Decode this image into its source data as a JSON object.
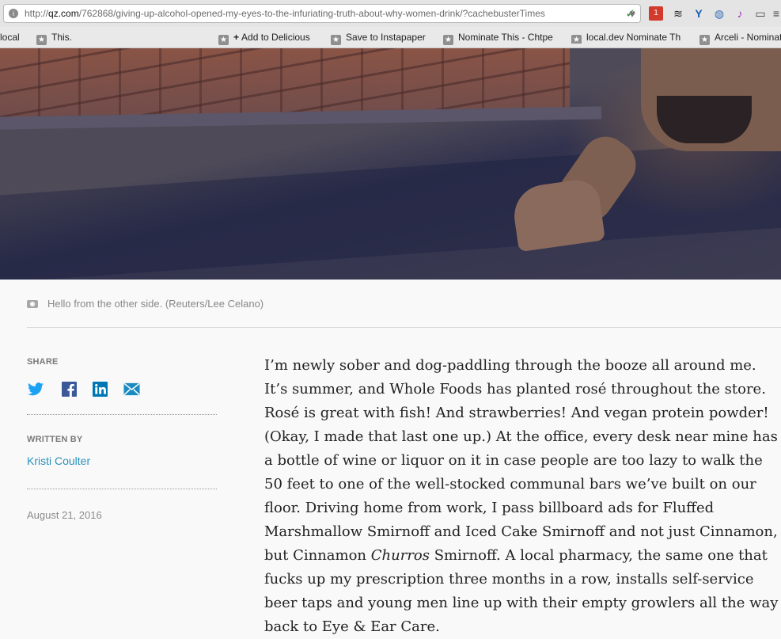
{
  "browser": {
    "url_prefix": "http://",
    "url_host": "qz.com",
    "url_path": "/762868/giving-up-alcohol-opened-my-eyes-to-the-infuriating-truth-about-why-women-drink/?cachebusterTimes",
    "extensions": [
      "check-icon",
      "heart-icon",
      "badge-icon",
      "layers-icon",
      "y-icon",
      "globe-icon",
      "music-icon",
      "cast-icon",
      "menu-icon"
    ]
  },
  "bookmarks": {
    "items": [
      "local",
      "This.",
      "Add to Delicious",
      "Save to Instapaper",
      "Nominate This - Chtpe",
      "local.dev Nominate Th",
      "Arceli - Nominat"
    ]
  },
  "photo": {
    "caption": "Hello from the other side. (Reuters/Lee Celano)"
  },
  "sidebar": {
    "share_label": "SHARE",
    "share_icons": [
      "twitter-icon",
      "facebook-icon",
      "linkedin-icon",
      "email-icon"
    ],
    "written_by_label": "WRITTEN BY",
    "author": "Kristi Coulter",
    "date": "August 21, 2016"
  },
  "article": {
    "text_before_italic": "I’m newly sober and dog-paddling through the booze all around me. It’s summer, and Whole Foods has planted rosé throughout the store. Rosé is great with fish! And strawberries! And vegan protein powder! (Okay, I made that last one up.) At the office, every desk near mine has a bottle of wine or liquor on it in case people are too lazy to walk the 50 feet to one of the well-stocked communal bars we’ve built on our floor. Driving home from work, I pass billboard ads for Fluffed Marshmallow Smirnoff and Iced Cake Smirnoff and not just Cinnamon, but Cinnamon ",
    "italic": "Churros",
    "text_after_italic": " Smirnoff. A local pharmacy, the same one that fucks up my prescription three months in a row, installs self-service beer taps and young men line up with their empty growlers all the way back to Eye & Ear Care."
  },
  "colors": {
    "author_link": "#2a91b9",
    "twitter": "#1da1f2",
    "facebook": "#3b5998",
    "linkedin": "#0077b5",
    "email": "#1a8ac0"
  }
}
